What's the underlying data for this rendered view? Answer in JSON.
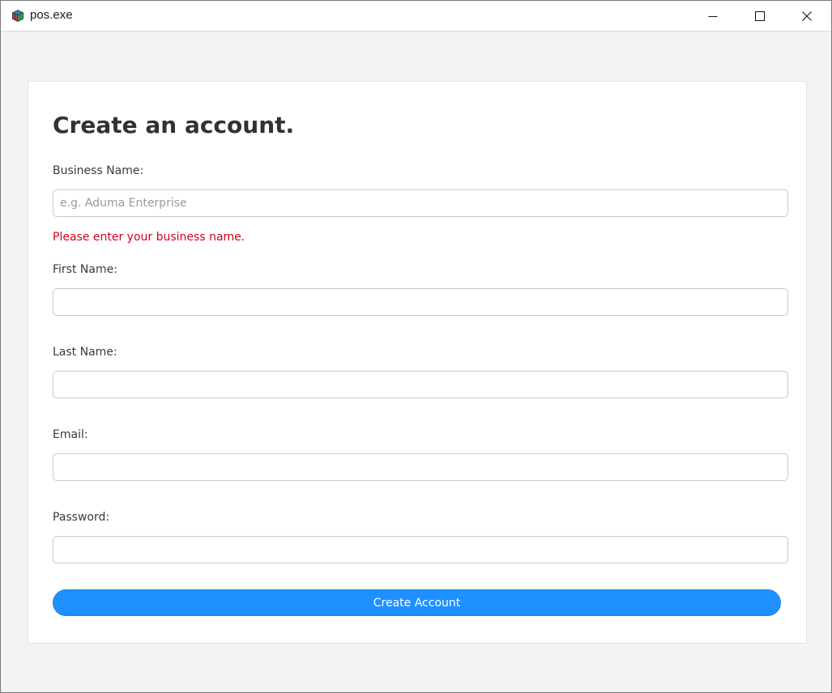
{
  "window": {
    "title": "pos.exe",
    "minimize_icon": "minimize-icon",
    "maximize_icon": "maximize-icon",
    "close_icon": "close-icon"
  },
  "form": {
    "heading": "Create an account.",
    "business_name": {
      "label": "Business Name:",
      "placeholder": "e.g. Aduma Enterprise",
      "value": "",
      "error": "Please enter your business name."
    },
    "first_name": {
      "label": "First Name:",
      "value": ""
    },
    "last_name": {
      "label": "Last Name:",
      "value": ""
    },
    "email": {
      "label": "Email:",
      "value": ""
    },
    "password": {
      "label": "Password:",
      "value": ""
    },
    "submit_label": "Create Account"
  },
  "colors": {
    "accent": "#1e90ff",
    "error": "#d0021b",
    "heading": "#2f3337",
    "background": "#f4f3f2"
  }
}
